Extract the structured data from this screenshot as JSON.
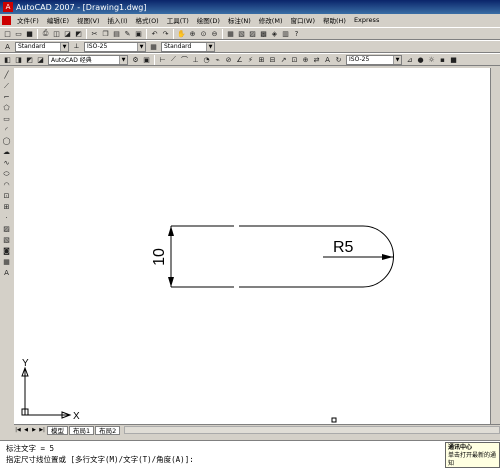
{
  "window": {
    "title": "AutoCAD 2007 - [Drawing1.dwg]"
  },
  "menu": [
    "文件(F)",
    "编辑(E)",
    "视图(V)",
    "插入(I)",
    "格式(O)",
    "工具(T)",
    "绘图(D)",
    "标注(N)",
    "修改(M)",
    "窗口(W)",
    "帮助(H)",
    "Express"
  ],
  "styles": {
    "text_style": "Standard",
    "dim_style": "ISO-25",
    "table_style": "Standard",
    "workspace": "AutoCAD 经典",
    "dim_style_2": "ISO-25"
  },
  "drawing": {
    "dim_vertical": "10",
    "dim_radius": "R5"
  },
  "ucs": {
    "x": "X",
    "y": "Y"
  },
  "layout_tabs": [
    "模型",
    "布局1",
    "布局2"
  ],
  "command_lines": [
    "标注文字 = 5",
    "指定尺寸线位置或 [多行文字(M)/文字(T)/角度(A)]:"
  ],
  "balloon": {
    "title": "通讯中心",
    "text": "单击打开最新的通知"
  },
  "colors": {
    "title_bar": "#0a246a",
    "canvas": "#ffffff",
    "ui": "#d4d0c8"
  }
}
